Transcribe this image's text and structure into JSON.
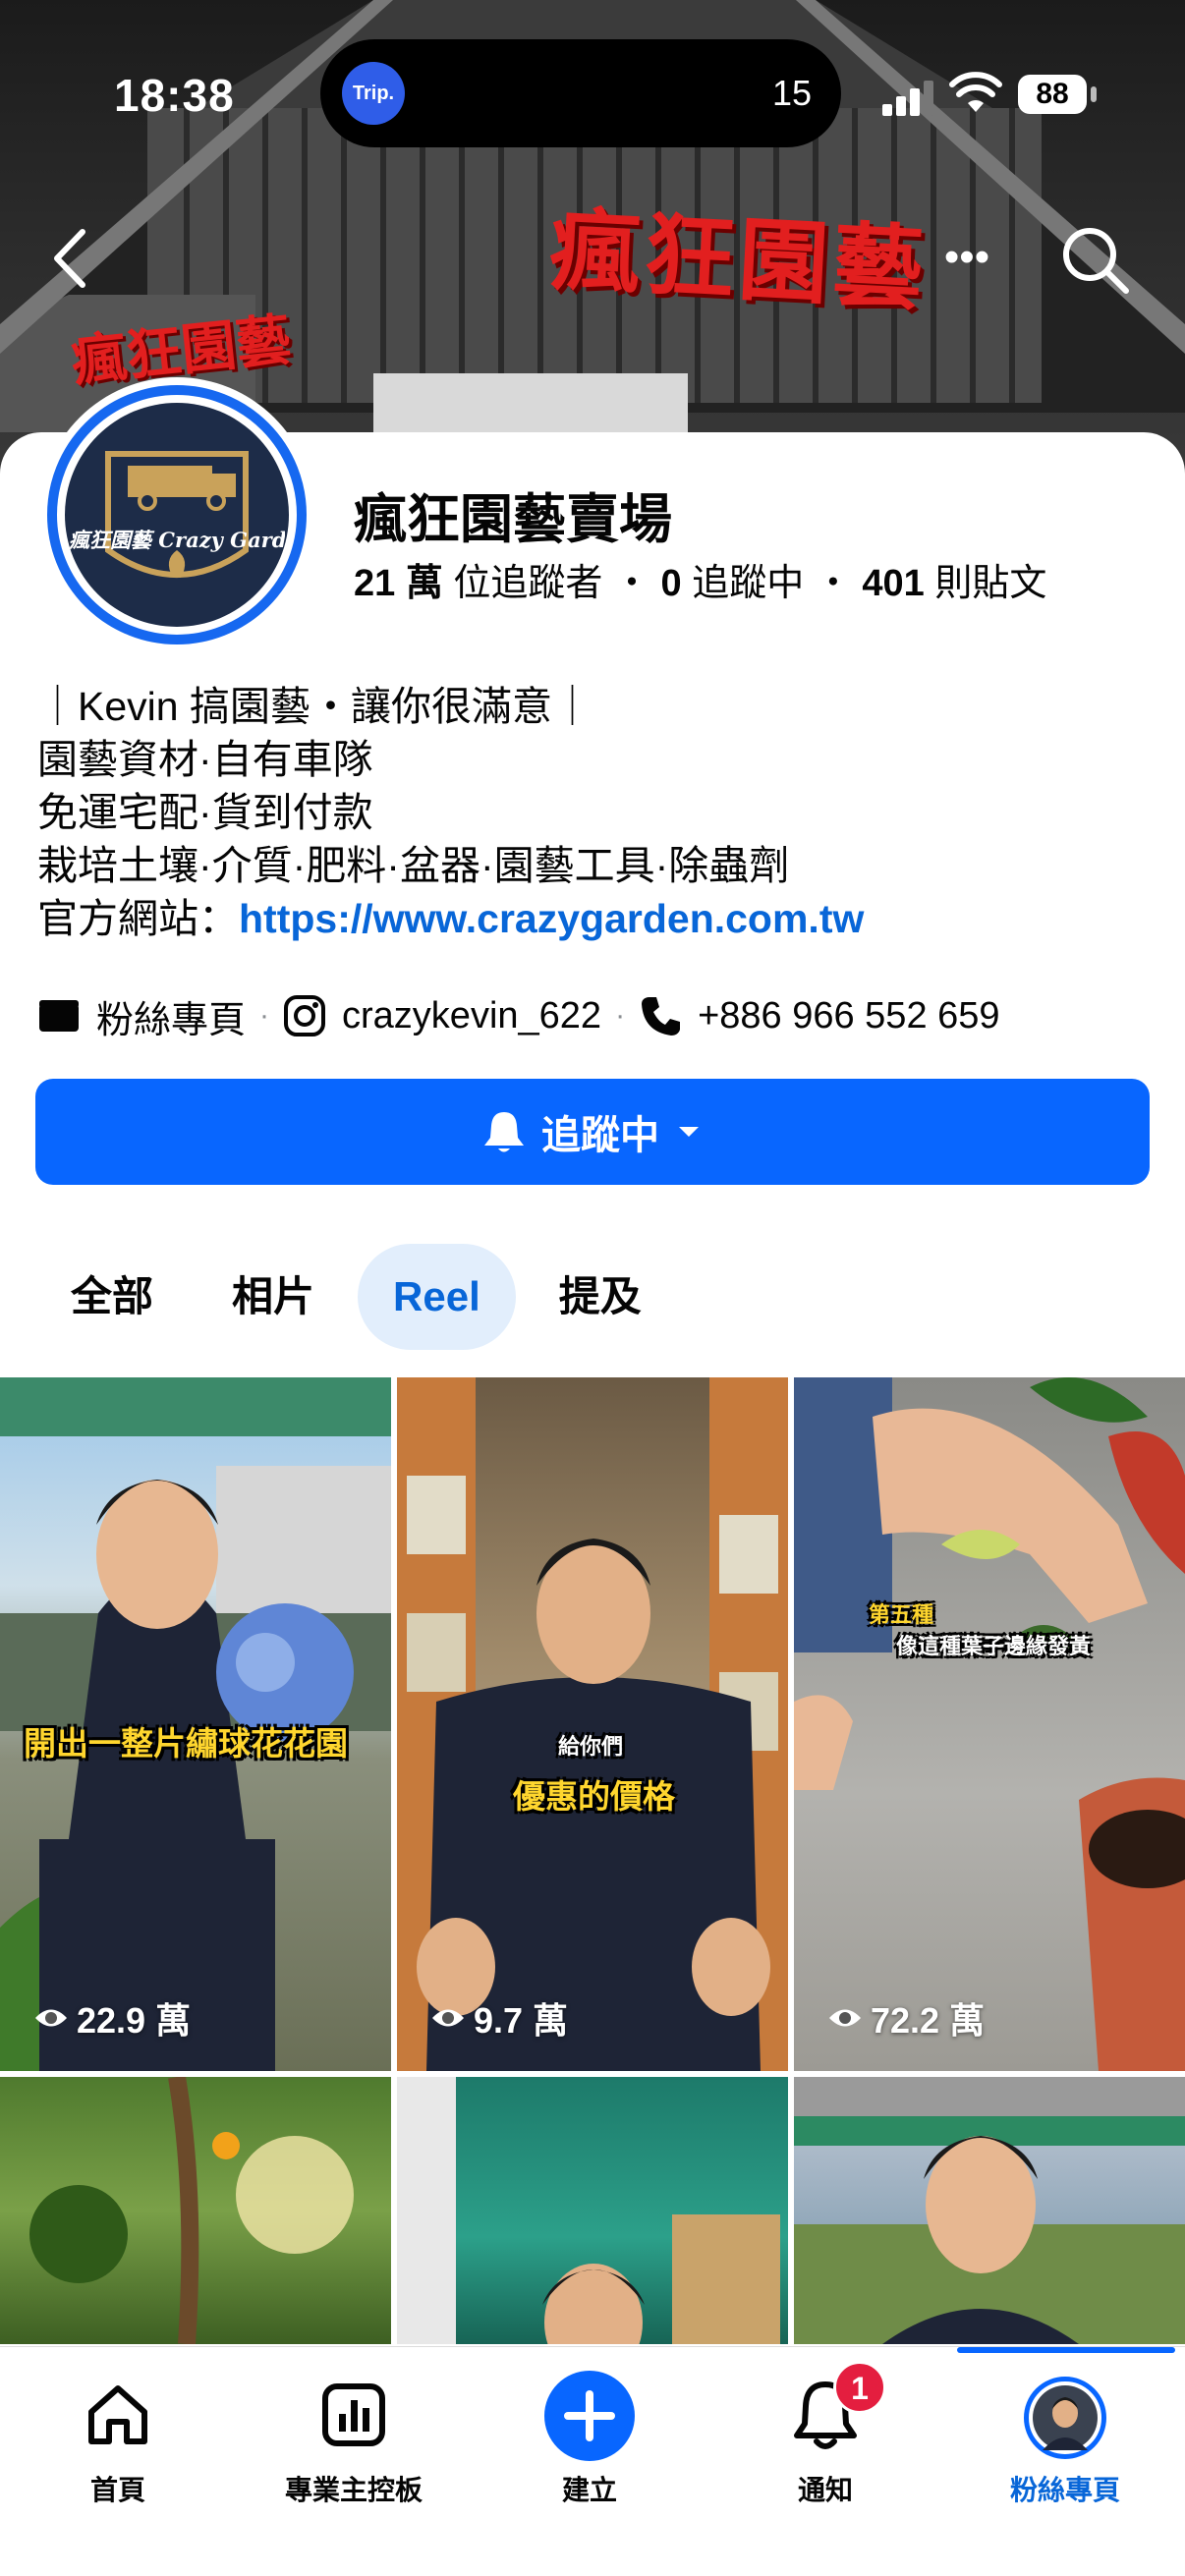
{
  "status_bar": {
    "time": "18:38",
    "trip_badge": "Trip.",
    "island_count": "15",
    "battery": "88"
  },
  "page": {
    "name": "瘋狂園藝賣場",
    "followers": "21 萬",
    "followers_label": "位追蹤者",
    "following": "0",
    "following_label": "追蹤中",
    "posts": "401",
    "posts_label": "則貼文",
    "separator": "・"
  },
  "cover": {
    "sign_main": "瘋狂園藝",
    "sign_side": "瘋狂園藝"
  },
  "avatar": {
    "logo_text": "瘋狂園藝 Crazy Garde"
  },
  "bio": {
    "line1": "｜Kevin 搞園藝・讓你很滿意｜",
    "line2": "園藝資材·自有車隊",
    "line3": "免運宅配·貨到付款",
    "line4": "栽培土壤·介質·肥料·盆器·園藝工具·除蟲劑",
    "website_label": "官方網站：",
    "website_url": "https://www.crazygarden.com.tw"
  },
  "contacts": {
    "page_type": "粉絲專頁",
    "instagram": "crazykevin_622",
    "phone": "+886 966 552 659",
    "dot": "·"
  },
  "follow_button": {
    "label": "追蹤中"
  },
  "tabs": [
    {
      "label": "全部"
    },
    {
      "label": "相片"
    },
    {
      "label": "Reel",
      "active": true
    },
    {
      "label": "提及"
    }
  ],
  "reels": [
    {
      "views": "22.9 萬",
      "caption": "開出一整片繡球花花園"
    },
    {
      "views": "9.7 萬",
      "caption_small": "給你們",
      "caption": "優惠的價格"
    },
    {
      "views": "72.2 萬",
      "caption_small": "第五種",
      "caption": "像這種葉子邊緣發黃"
    },
    {
      "views": ""
    },
    {
      "views": ""
    },
    {
      "views": ""
    }
  ],
  "bottom_nav": [
    {
      "label": "首頁",
      "icon": "home-icon"
    },
    {
      "label": "專業主控板",
      "icon": "dashboard-icon"
    },
    {
      "label": "建立",
      "icon": "plus-icon"
    },
    {
      "label": "通知",
      "icon": "bell-icon",
      "badge": "1"
    },
    {
      "label": "粉絲專頁",
      "icon": "avatar",
      "active": true
    }
  ],
  "colors": {
    "accent": "#0866ff",
    "link": "#0866d8",
    "active_tab_bg": "#e2eefc",
    "badge": "#e41e3f"
  }
}
